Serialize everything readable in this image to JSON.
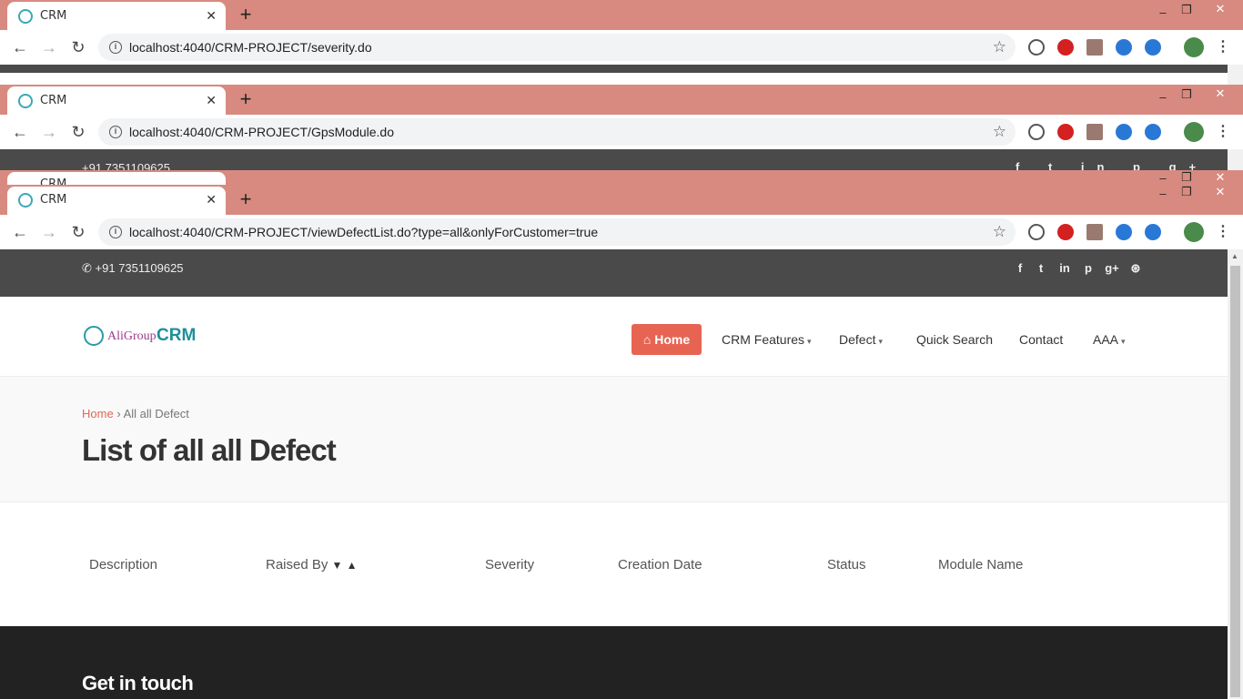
{
  "windows": [
    {
      "tab_title": "CRM",
      "url": "localhost:4040/CRM-PROJECT/severity.do"
    },
    {
      "tab_title": "CRM",
      "url": "localhost:4040/CRM-PROJECT/GpsModule.do"
    },
    {
      "tab_title": "CRM",
      "url": "localhost:4040/CRM-PROJECT/viewDefectList.do?type=all&onlyForCustomer=true"
    }
  ],
  "peek_strip": {
    "phone": "+91 7351109625",
    "tab_title": "CRM"
  },
  "topbar": {
    "phone": "+91 7351109625",
    "social_icons": [
      "facebook-icon",
      "twitter-icon",
      "linkedin-icon",
      "pinterest-icon",
      "google-plus-icon",
      "dribbble-icon"
    ]
  },
  "logo": {
    "group": "AliGroup",
    "crm": "CRM"
  },
  "nav": {
    "home": "Home",
    "features": "CRM Features",
    "defect": "Defect",
    "quick_search": "Quick Search",
    "contact": "Contact",
    "user": "AAA"
  },
  "breadcrumb": {
    "home": "Home",
    "separator": "›",
    "current": "All all Defect"
  },
  "page_title": "List of all all Defect",
  "table": {
    "headers": [
      "Description",
      "Raised By",
      "Severity",
      "Creation Date",
      "Status",
      "Module Name"
    ]
  },
  "footer": {
    "title": "Get in touch"
  },
  "colors": {
    "tabstrip": "#d88a80",
    "accent": "#e76453",
    "topbar": "#4a4a4a",
    "footer": "#222222"
  }
}
